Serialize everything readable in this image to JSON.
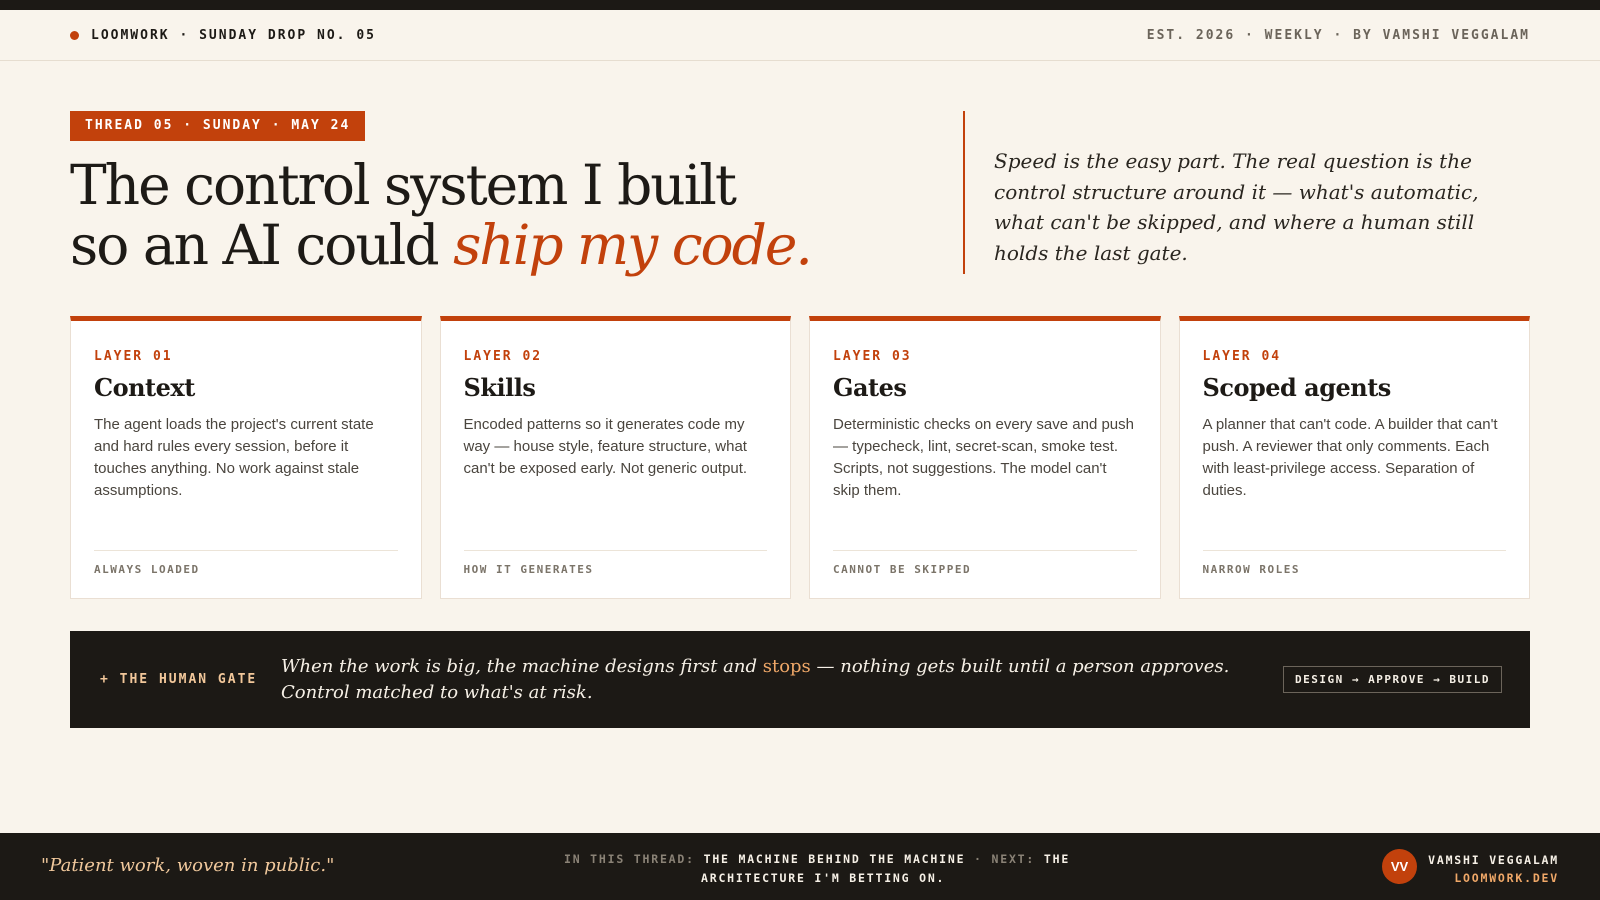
{
  "masthead": {
    "brand": "LOOMWORK · SUNDAY DROP NO. 05",
    "meta": "EST. 2026 · WEEKLY · BY VAMSHI VEGGALAM"
  },
  "hero": {
    "tag": "THREAD 05 · SUNDAY · MAY 24",
    "headline_line1": "The control system I built",
    "headline_line2_plain": "so an AI could ",
    "headline_line2_accent": "ship my code.",
    "pullquote": "Speed is the easy part. The real question is the control structure around it — what's automatic, what can't be skipped, and where a human still holds the last gate."
  },
  "cards": [
    {
      "layer": "LAYER 01",
      "title": "Context",
      "body": "The agent loads the project's current state and hard rules every session, before it touches anything. No work against stale assumptions.",
      "foot": "ALWAYS LOADED"
    },
    {
      "layer": "LAYER 02",
      "title": "Skills",
      "body": "Encoded patterns so it generates code my way — house style, feature structure, what can't be exposed early. Not generic output.",
      "foot": "HOW IT GENERATES"
    },
    {
      "layer": "LAYER 03",
      "title": "Gates",
      "body": "Deterministic checks on every save and push — typecheck, lint, secret-scan, smoke test. Scripts, not suggestions. The model can't skip them.",
      "foot": "CANNOT BE SKIPPED"
    },
    {
      "layer": "LAYER 04",
      "title": "Scoped agents",
      "body": "A planner that can't code. A builder that can't push. A reviewer that only comments. Each with least-privilege access. Separation of duties.",
      "foot": "NARROW ROLES"
    }
  ],
  "gate": {
    "label": "+ THE HUMAN GATE",
    "text_before": "When the work is big, the machine designs first and ",
    "text_accent": "stops",
    "text_after": " — nothing gets built until a person approves. Control matched to what's at risk.",
    "flow": "DESIGN → APPROVE → BUILD"
  },
  "footer": {
    "motto": "\"Patient work, woven in public.\"",
    "thread_label": "IN THIS THREAD:",
    "thread_value": "THE MACHINE BEHIND THE MACHINE",
    "separator": "·",
    "next_label": "NEXT:",
    "next_value_1": "THE",
    "next_value_2": "ARCHITECTURE I'M BETTING ON.",
    "avatar_initials": "VV",
    "author": "VAMSHI VEGGALAM",
    "site": "LOOMWORK.DEV"
  },
  "colors": {
    "accent": "#c2410c",
    "dark": "#1c1915",
    "background": "#f9f4ec"
  }
}
